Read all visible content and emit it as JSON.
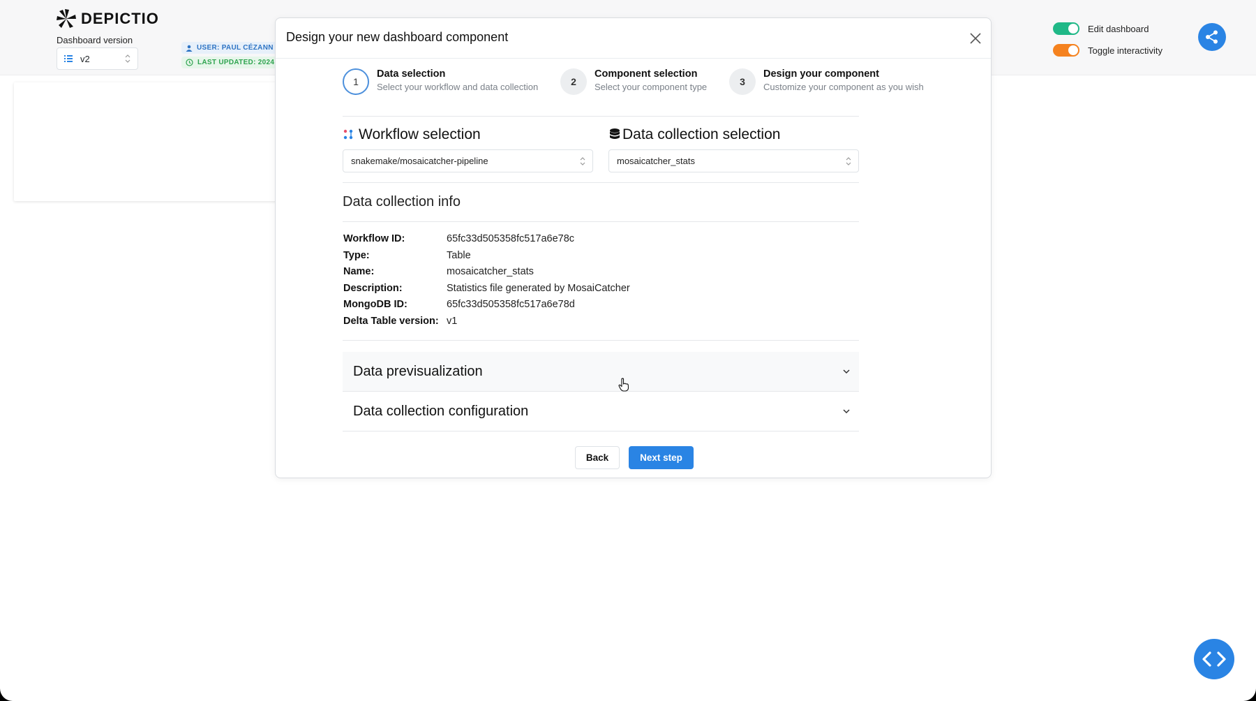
{
  "app": {
    "logo_text": "DEPICTIO",
    "version_label": "Dashboard version",
    "version_value": "v2",
    "user_badge": "USER: PAUL CÉZANN",
    "updated_badge": "LAST UPDATED: 2024",
    "switches": [
      {
        "label": "Edit dashboard",
        "color": "#20b887",
        "on": true
      },
      {
        "label": "Toggle interactivity",
        "color": "#f5821f",
        "on": true
      }
    ],
    "accent_color": "#2a84e4"
  },
  "modal": {
    "title": "Design your new dashboard component",
    "steps": [
      {
        "number": "1",
        "title": "Data selection",
        "description": "Select your workflow and data collection"
      },
      {
        "number": "2",
        "title": "Component selection",
        "description": "Select your component type"
      },
      {
        "number": "3",
        "title": "Design your component",
        "description": "Customize your component as you wish"
      }
    ],
    "workflow": {
      "title": "Workflow selection",
      "icon": "workflow-icon",
      "value": "snakemake/mosaicatcher-pipeline"
    },
    "data_collection": {
      "title": "Data collection selection",
      "icon": "database-icon",
      "value": "mosaicatcher_stats"
    },
    "info": {
      "title": "Data collection info",
      "rows": [
        {
          "key": "Workflow ID:",
          "value": "65fc33d505358fc517a6e78c"
        },
        {
          "key": "Type:",
          "value": "Table"
        },
        {
          "key": "Name:",
          "value": "mosaicatcher_stats"
        },
        {
          "key": "Description:",
          "value": "Statistics file generated by MosaiCatcher"
        },
        {
          "key": "MongoDB ID:",
          "value": "65fc33d505358fc517a6e78d"
        },
        {
          "key": "Delta Table version:",
          "value": "v1"
        }
      ]
    },
    "accordions": {
      "previsualization": "Data previsualization",
      "configuration": "Data collection configuration"
    },
    "buttons": {
      "back": "Back",
      "next": "Next step"
    }
  }
}
